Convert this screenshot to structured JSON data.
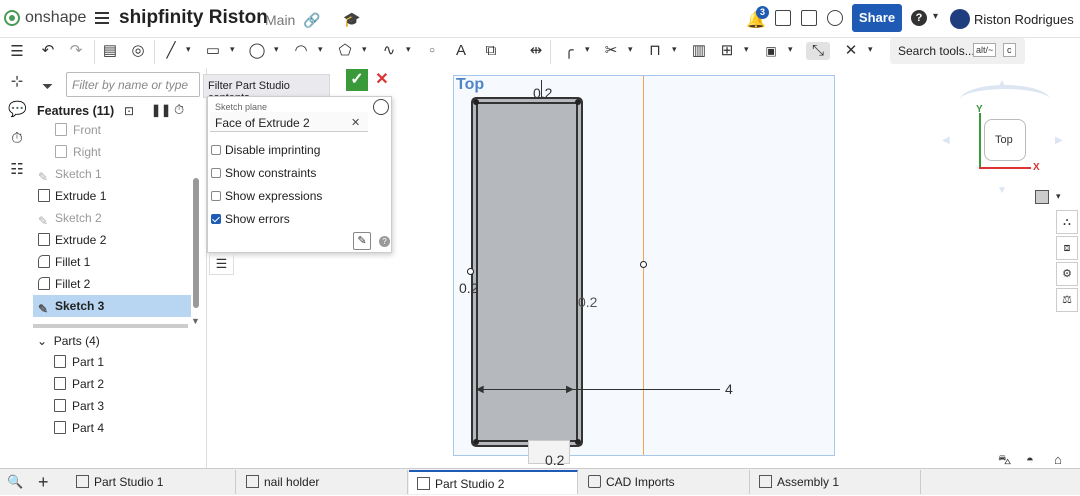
{
  "app": {
    "logo_text": "onshape",
    "doc_title": "shipfinity Riston",
    "branch": "Main",
    "notification_count": "3",
    "share_label": "Share",
    "help_label": "?",
    "user_name": "Riston Rodrigues"
  },
  "toolbar": {
    "search_label": "Search tools...",
    "kbd1": "alt/~",
    "kbd2": "c"
  },
  "features": {
    "filter_placeholder": "Filter by name or type",
    "heading": "Features (11)",
    "items": [
      {
        "label": "Front",
        "state": "dim",
        "icon": "plane-icon"
      },
      {
        "label": "Right",
        "state": "dim",
        "icon": "plane-icon"
      },
      {
        "label": "Sketch 1",
        "state": "dim",
        "icon": "sketch-icon"
      },
      {
        "label": "Extrude 1",
        "state": "normal",
        "icon": "extrude-icon"
      },
      {
        "label": "Sketch 2",
        "state": "dim",
        "icon": "sketch-icon"
      },
      {
        "label": "Extrude 2",
        "state": "normal",
        "icon": "extrude-icon"
      },
      {
        "label": "Fillet 1",
        "state": "normal",
        "icon": "fillet-icon"
      },
      {
        "label": "Fillet 2",
        "state": "normal",
        "icon": "fillet-icon"
      },
      {
        "label": "Sketch 3",
        "state": "selected",
        "icon": "sketch-icon"
      }
    ],
    "parts_heading": "Parts (4)",
    "parts": [
      "Part 1",
      "Part 2",
      "Part 3",
      "Part 4"
    ]
  },
  "dialog": {
    "filter_pill": "Filter Part Studio contents",
    "plane_label": "Sketch plane",
    "plane_value": "Face of Extrude 2",
    "clear_glyph": "✕",
    "checkboxes": [
      {
        "label": "Disable imprinting",
        "checked": false
      },
      {
        "label": "Show constraints",
        "checked": false
      },
      {
        "label": "Show expressions",
        "checked": false
      },
      {
        "label": "Show errors",
        "checked": true
      }
    ],
    "help": "?"
  },
  "viewport": {
    "plane_label": "Top",
    "dim_top": "0.2",
    "dim_left": "0.2",
    "dim_right": "0.2",
    "dim_bottom": "0.2",
    "dim_width": "4",
    "navcube_label": "Top",
    "axis_y": "Y",
    "axis_x": "X"
  },
  "tabs": [
    {
      "label": "Part Studio 1",
      "active": false
    },
    {
      "label": "nail holder",
      "active": false
    },
    {
      "label": "Part Studio 2",
      "active": true
    },
    {
      "label": "CAD Imports",
      "active": false
    },
    {
      "label": "Assembly 1",
      "active": false
    }
  ],
  "colors": {
    "accent": "#1f5bb5",
    "confirm": "#3a9a3a",
    "cancel": "#dd3333",
    "selected_row": "#b8d6f2",
    "sketch_fill": "#b5b8bc",
    "construction_line": "#f2a54a"
  }
}
